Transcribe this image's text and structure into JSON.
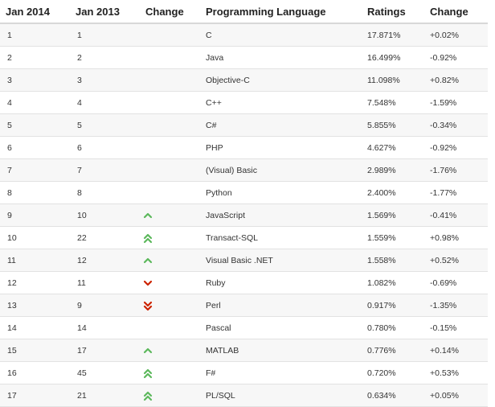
{
  "colors": {
    "up": "#5cb85c",
    "down": "#cc2200"
  },
  "headers": {
    "current": "Jan 2014",
    "previous": "Jan 2013",
    "change": "Change",
    "language": "Programming Language",
    "ratings": "Ratings",
    "delta": "Change"
  },
  "rows": [
    {
      "current": "1",
      "previous": "1",
      "trend": "none",
      "language": "C",
      "rating": "17.871%",
      "delta": "+0.02%"
    },
    {
      "current": "2",
      "previous": "2",
      "trend": "none",
      "language": "Java",
      "rating": "16.499%",
      "delta": "-0.92%"
    },
    {
      "current": "3",
      "previous": "3",
      "trend": "none",
      "language": "Objective-C",
      "rating": "11.098%",
      "delta": "+0.82%"
    },
    {
      "current": "4",
      "previous": "4",
      "trend": "none",
      "language": "C++",
      "rating": "7.548%",
      "delta": "-1.59%"
    },
    {
      "current": "5",
      "previous": "5",
      "trend": "none",
      "language": "C#",
      "rating": "5.855%",
      "delta": "-0.34%"
    },
    {
      "current": "6",
      "previous": "6",
      "trend": "none",
      "language": "PHP",
      "rating": "4.627%",
      "delta": "-0.92%"
    },
    {
      "current": "7",
      "previous": "7",
      "trend": "none",
      "language": "(Visual) Basic",
      "rating": "2.989%",
      "delta": "-1.76%"
    },
    {
      "current": "8",
      "previous": "8",
      "trend": "none",
      "language": "Python",
      "rating": "2.400%",
      "delta": "-1.77%"
    },
    {
      "current": "9",
      "previous": "10",
      "trend": "up",
      "language": "JavaScript",
      "rating": "1.569%",
      "delta": "-0.41%"
    },
    {
      "current": "10",
      "previous": "22",
      "trend": "double-up",
      "language": "Transact-SQL",
      "rating": "1.559%",
      "delta": "+0.98%"
    },
    {
      "current": "11",
      "previous": "12",
      "trend": "up",
      "language": "Visual Basic .NET",
      "rating": "1.558%",
      "delta": "+0.52%"
    },
    {
      "current": "12",
      "previous": "11",
      "trend": "down",
      "language": "Ruby",
      "rating": "1.082%",
      "delta": "-0.69%"
    },
    {
      "current": "13",
      "previous": "9",
      "trend": "double-down",
      "language": "Perl",
      "rating": "0.917%",
      "delta": "-1.35%"
    },
    {
      "current": "14",
      "previous": "14",
      "trend": "none",
      "language": "Pascal",
      "rating": "0.780%",
      "delta": "-0.15%"
    },
    {
      "current": "15",
      "previous": "17",
      "trend": "up",
      "language": "MATLAB",
      "rating": "0.776%",
      "delta": "+0.14%"
    },
    {
      "current": "16",
      "previous": "45",
      "trend": "double-up",
      "language": "F#",
      "rating": "0.720%",
      "delta": "+0.53%"
    },
    {
      "current": "17",
      "previous": "21",
      "trend": "double-up",
      "language": "PL/SQL",
      "rating": "0.634%",
      "delta": "+0.05%"
    }
  ]
}
